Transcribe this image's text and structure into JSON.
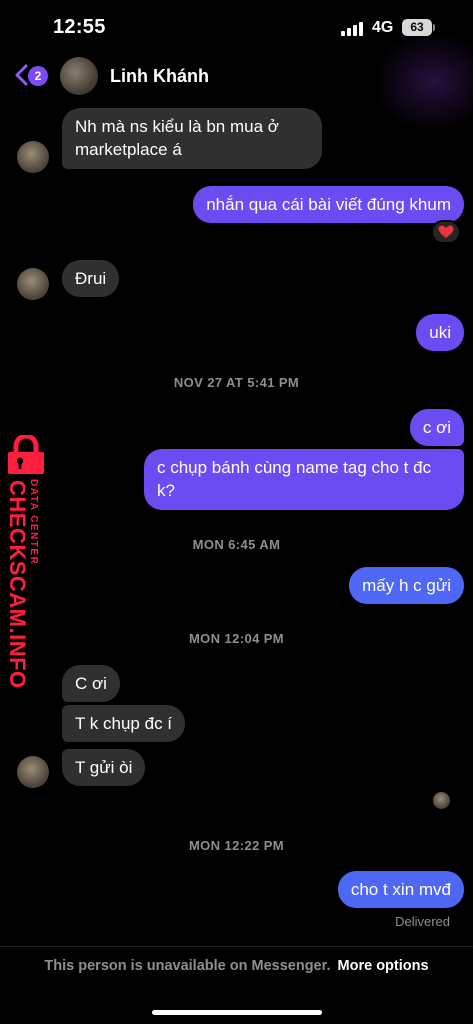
{
  "status_bar": {
    "time": "12:55",
    "network": "4G",
    "battery": "63"
  },
  "header": {
    "back_count": "2",
    "contact_name": "Linh Khánh"
  },
  "messages": [
    {
      "dir": "in",
      "text": "Nh mà ns kiểu là bn mua ở marketplace á"
    },
    {
      "dir": "out",
      "text": "nhắn qua cái bài viết đúng khum",
      "reaction": "❤️"
    },
    {
      "dir": "in",
      "text": "Đrui"
    },
    {
      "dir": "out",
      "text": "uki"
    },
    {
      "dir": "stamp",
      "text": "NOV 27 AT 5:41 PM"
    },
    {
      "dir": "out",
      "text": "c ơi"
    },
    {
      "dir": "out",
      "text": "c chụp bánh cùng name tag cho t đc k?"
    },
    {
      "dir": "stamp",
      "text": "MON 6:45 AM"
    },
    {
      "dir": "out",
      "text": "mấy h c gửi"
    },
    {
      "dir": "stamp",
      "text": "MON 12:04 PM"
    },
    {
      "dir": "in",
      "text": "C ơi"
    },
    {
      "dir": "in",
      "text": "T k chụp đc í"
    },
    {
      "dir": "in",
      "text": "T gửi òi"
    },
    {
      "dir": "stamp",
      "text": "MON 12:22 PM"
    },
    {
      "dir": "out",
      "text": "cho t xin mvđ"
    }
  ],
  "delivery_status": "Delivered",
  "watermark": {
    "main": "CHECKSCAM.INFO",
    "sub": "DATA CENTER"
  },
  "footer": {
    "notice": "This person is unavailable on Messenger.",
    "link": "More options"
  },
  "colors": {
    "outgoing_purple": "#6b4cf3",
    "outgoing_blue": "#4f67f5",
    "incoming": "#303030",
    "accent": "#7b4cf6",
    "watermark": "#ff1f3d"
  }
}
